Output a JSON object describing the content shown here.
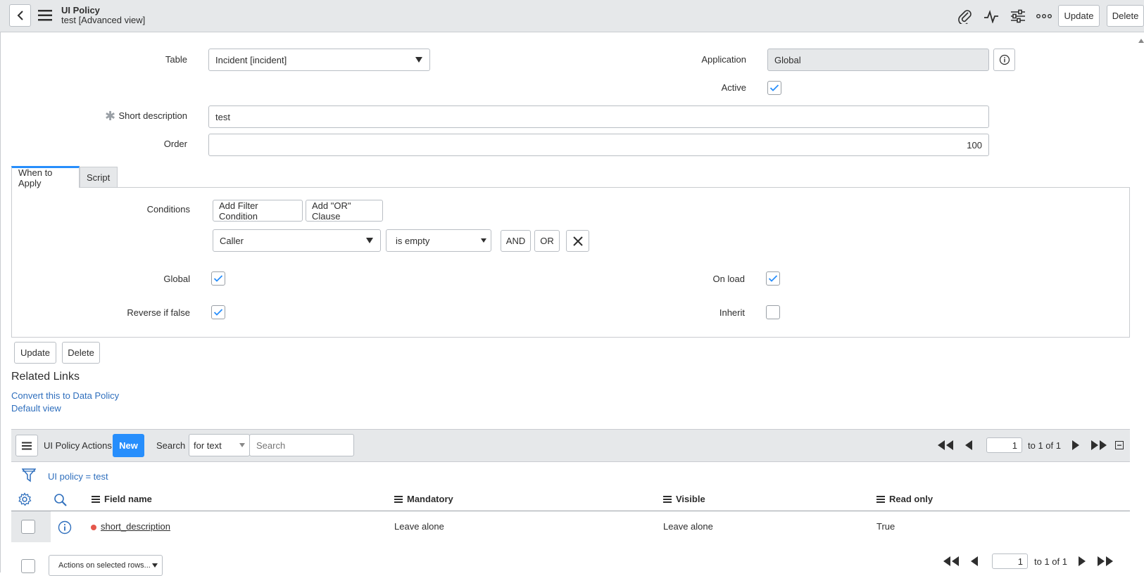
{
  "header": {
    "title": "UI Policy",
    "subtitle": "test [Advanced view]",
    "update_label": "Update",
    "delete_label": "Delete"
  },
  "form": {
    "table_label": "Table",
    "table_value": "Incident [incident]",
    "application_label": "Application",
    "application_value": "Global",
    "active_label": "Active",
    "short_description_label": "Short description",
    "short_description_value": "test",
    "order_label": "Order",
    "order_value": "100"
  },
  "tabs": [
    {
      "label": "When to Apply"
    },
    {
      "label": "Script"
    }
  ],
  "conditions": {
    "label": "Conditions",
    "add_filter_label": "Add Filter Condition",
    "add_or_label": "Add \"OR\" Clause",
    "field_value": "Caller",
    "operator_value": "is empty",
    "and_label": "AND",
    "or_label": "OR"
  },
  "flags": {
    "global_label": "Global",
    "onload_label": "On load",
    "reverse_label": "Reverse if false",
    "inherit_label": "Inherit"
  },
  "bottom_buttons": {
    "update_label": "Update",
    "delete_label": "Delete"
  },
  "related_links": {
    "heading": "Related Links",
    "items": [
      {
        "label": "Convert this to Data Policy"
      },
      {
        "label": "Default view"
      }
    ]
  },
  "related_list": {
    "title": "UI Policy Actions",
    "new_label": "New",
    "search_label": "Search",
    "search_type": "for text",
    "search_placeholder": "Search",
    "page_value": "1",
    "page_info": "to 1 of 1",
    "filter_breadcrumb": "UI policy = test",
    "columns": [
      "Field name",
      "Mandatory",
      "Visible",
      "Read only"
    ],
    "rows": [
      {
        "field_name": "short_description",
        "mandatory": "Leave alone",
        "visible": "Leave alone",
        "read_only": "True"
      }
    ],
    "actions_placeholder": "Actions on selected rows...",
    "footer_page_value": "1",
    "footer_page_info": "to 1 of 1"
  },
  "colors": {
    "accent": "#278efc",
    "link": "#2f6fbd",
    "header_bg": "#e6e8ea",
    "required_dot": "#e5574b"
  }
}
